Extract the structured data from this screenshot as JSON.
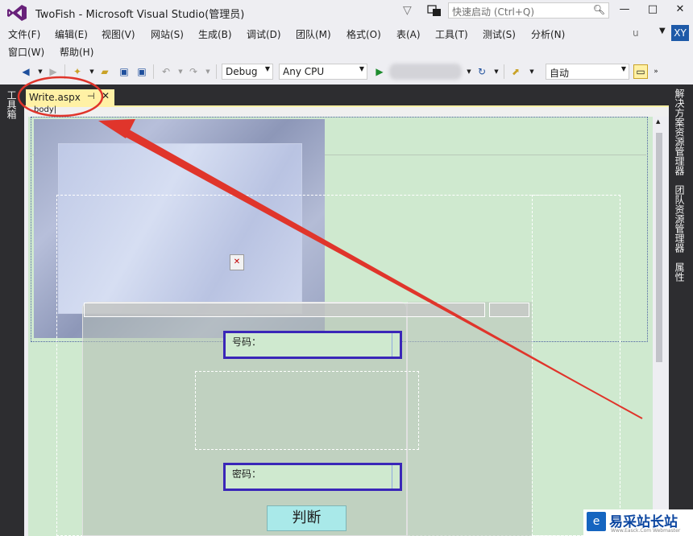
{
  "window": {
    "title": "TwoFish - Microsoft Visual Studio(管理员)",
    "quick_launch_placeholder": "快速启动 (Ctrl+Q)",
    "controls": [
      "—",
      "□",
      "✕"
    ]
  },
  "menu": [
    "文件(F)",
    "编辑(E)",
    "视图(V)",
    "网站(S)",
    "生成(B)",
    "调试(D)",
    "团队(M)",
    "格式(O)",
    "表(A)",
    "工具(T)",
    "测试(S)",
    "分析(N)",
    "窗口(W)",
    "帮助(H)"
  ],
  "user": {
    "name": "u",
    "avatar": "XY"
  },
  "toolbar": {
    "config": "Debug",
    "platform": "Any CPU",
    "solution_config": "自动"
  },
  "left_panel": {
    "toolbox": "工具箱"
  },
  "right_panel": [
    "解决方案资源管理器",
    "团队资源管理器",
    "属性"
  ],
  "document": {
    "tab_label": "Write.aspx",
    "breadcrumb": "body",
    "fields": [
      {
        "label": "号码："
      },
      {
        "label": "密码："
      }
    ],
    "button_label": "判断"
  },
  "watermark": {
    "logo": "e",
    "text": "易采站长站",
    "sub": "Www.Easck.Com  Webmaster"
  },
  "colors": {
    "annotation": "#e0352b",
    "field_border": "#3a26b8",
    "tab_active": "#fff1a5",
    "design_bg": "#cfe9cf"
  }
}
